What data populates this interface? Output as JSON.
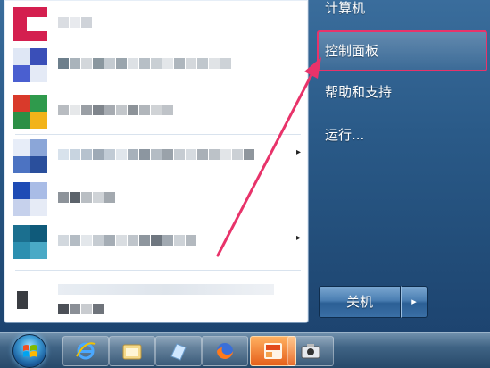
{
  "right_pane": {
    "items": [
      {
        "label": "计算机"
      },
      {
        "label": "控制面板"
      },
      {
        "label": "帮助和支持"
      },
      {
        "label": "运行..."
      }
    ],
    "highlighted_index": 1
  },
  "shutdown": {
    "label": "关机",
    "arrow": "▸"
  },
  "left_pane": {
    "submenu_arrow": "▸"
  },
  "colors": {
    "highlight_border": "#e8336a",
    "annotation_arrow": "#e8336a"
  },
  "icons": {
    "start": "windows-orb-icon",
    "ie": "internet-explorer-icon",
    "explorer": "folder-icon",
    "media": "media-player-icon",
    "firefox": "firefox-icon",
    "app": "app-icon",
    "camera": "camera-icon"
  }
}
